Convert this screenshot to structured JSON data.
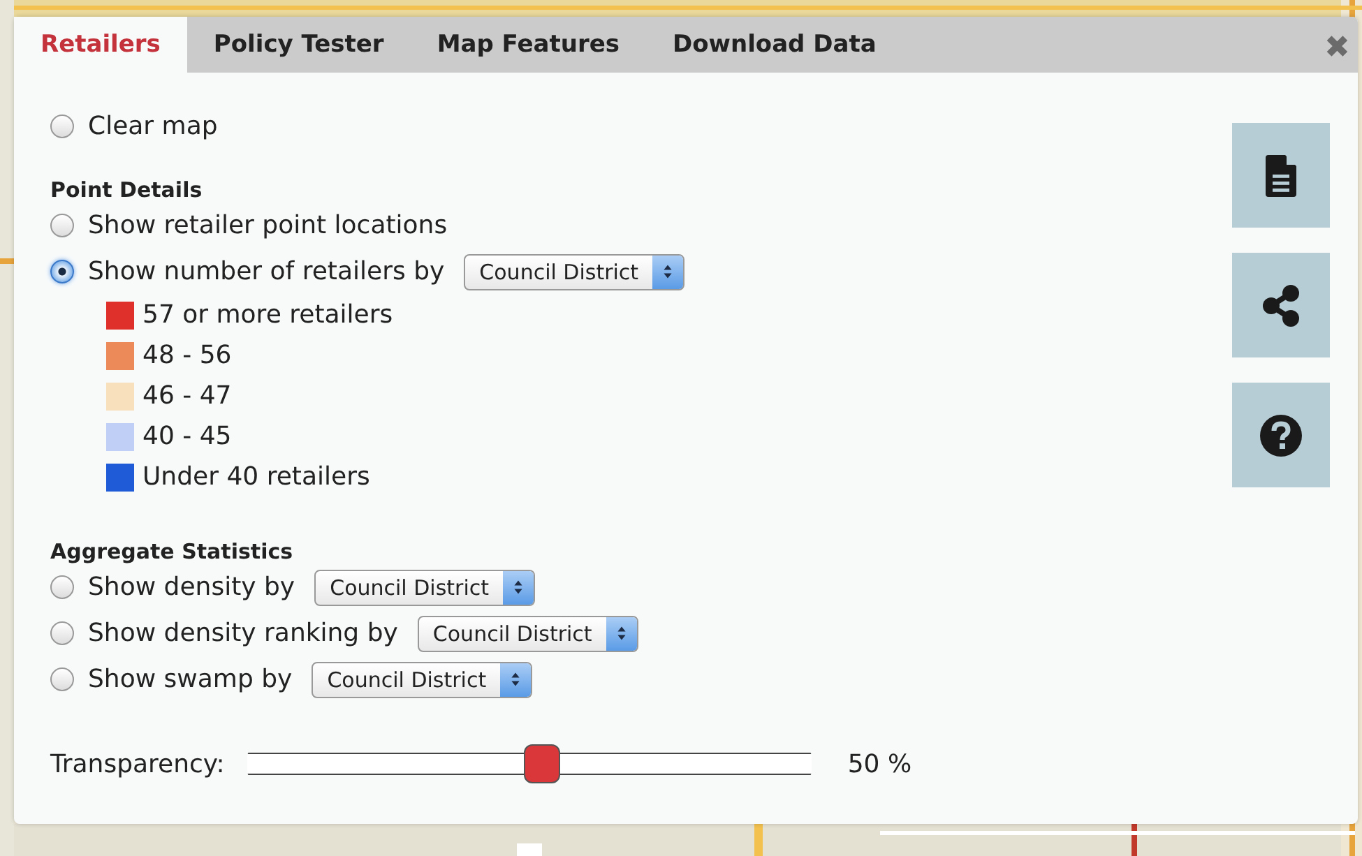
{
  "tabs": [
    {
      "label": "Retailers",
      "selected": true
    },
    {
      "label": "Policy Tester",
      "selected": false
    },
    {
      "label": "Map Features",
      "selected": false
    },
    {
      "label": "Download Data",
      "selected": false
    }
  ],
  "close": {
    "label": "✖"
  },
  "clear_map": {
    "label": "Clear map",
    "selected": false
  },
  "point_details": {
    "heading": "Point Details",
    "options": [
      {
        "label": "Show retailer point locations",
        "selected": false
      },
      {
        "label": "Show number of retailers by",
        "selected": true,
        "select": "Council District"
      }
    ],
    "legend": [
      {
        "label": "57 or more retailers",
        "color": "#e0302b"
      },
      {
        "label": "48 - 56",
        "color": "#ec8a5a"
      },
      {
        "label": "46 - 47",
        "color": "#f9e0bd"
      },
      {
        "label": "40 - 45",
        "color": "#bfcff5"
      },
      {
        "label": "Under 40 retailers",
        "color": "#1f5bd6"
      }
    ]
  },
  "aggregate_statistics": {
    "heading": "Aggregate Statistics",
    "options": [
      {
        "label": "Show density by",
        "selected": false,
        "select": "Council District"
      },
      {
        "label": "Show density ranking by",
        "selected": false,
        "select": "Council District"
      },
      {
        "label": "Show swamp by",
        "selected": false,
        "select": "Council District"
      }
    ]
  },
  "transparency": {
    "label": "Transparency:",
    "level": 0.5,
    "reading": "50 %"
  },
  "tools": [
    {
      "kind": "document"
    },
    {
      "kind": "share"
    },
    {
      "kind": "help"
    }
  ]
}
